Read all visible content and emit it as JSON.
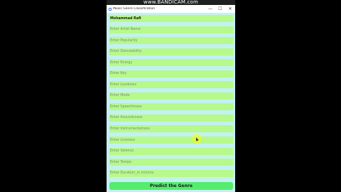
{
  "recording": {
    "watermark": "www.BANDICAM.com"
  },
  "window": {
    "title": "Music Genre Classification",
    "controls": {
      "minimize": "—",
      "maximize": "☐",
      "close": "✕"
    }
  },
  "fields": [
    {
      "value": "Mohammad Rafi",
      "placeholder": ""
    },
    {
      "value": "",
      "placeholder": "Enter Artist Name"
    },
    {
      "value": "",
      "placeholder": "Enter Popularity"
    },
    {
      "value": "",
      "placeholder": "Enter Danceability"
    },
    {
      "value": "",
      "placeholder": "Enter Energy"
    },
    {
      "value": "",
      "placeholder": "Enter Key"
    },
    {
      "value": "",
      "placeholder": "Enter Loudness"
    },
    {
      "value": "",
      "placeholder": "Enter Mode"
    },
    {
      "value": "",
      "placeholder": "Enter Speechiness"
    },
    {
      "value": "",
      "placeholder": "Enter Acousticness"
    },
    {
      "value": "",
      "placeholder": "Enter Instrumentalness"
    },
    {
      "value": "",
      "placeholder": "Enter Liveness"
    },
    {
      "value": "",
      "placeholder": "Enter Valence"
    },
    {
      "value": "",
      "placeholder": "Enter Tempo"
    },
    {
      "value": "",
      "placeholder": "Enter Duration_in min/ms"
    }
  ],
  "predict_button": {
    "label": "Predict the Genre"
  },
  "colors": {
    "background": "#c3f1f1",
    "field": "#b7f98a",
    "button": "#55ec6f"
  }
}
